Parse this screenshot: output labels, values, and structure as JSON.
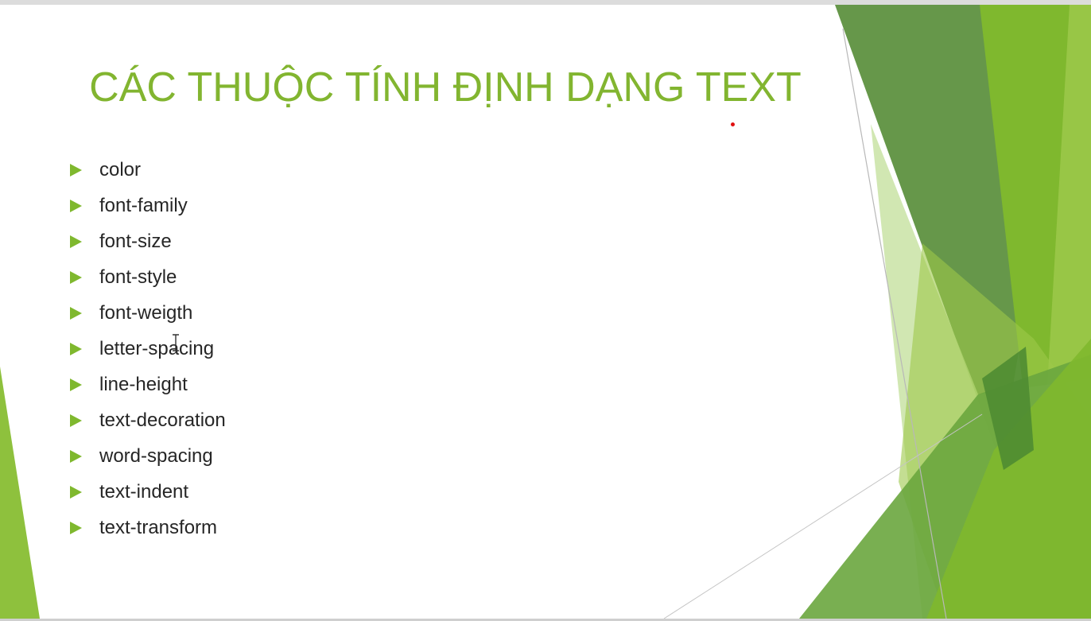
{
  "slide": {
    "title": "CÁC THUỘC TÍNH ĐỊNH DẠNG TEXT",
    "bullets": [
      "color",
      "font-family",
      "font-size",
      "font-style",
      "font-weigth",
      "letter-spacing",
      "line-height",
      "text-decoration",
      "word-spacing",
      "text-indent",
      "text-transform"
    ]
  },
  "theme": {
    "title_color": "#82b530",
    "bullet_color": "#7fb82e",
    "text_color": "#262626",
    "accent_greens": [
      "#5e9140",
      "#7fb82e",
      "#9cc84a",
      "#c9e3a4",
      "#4f8c32"
    ]
  },
  "icons": {
    "bullet": "triangle-right-icon",
    "pointer": "laser-pointer-dot",
    "cursor": "text-i-beam-cursor"
  }
}
